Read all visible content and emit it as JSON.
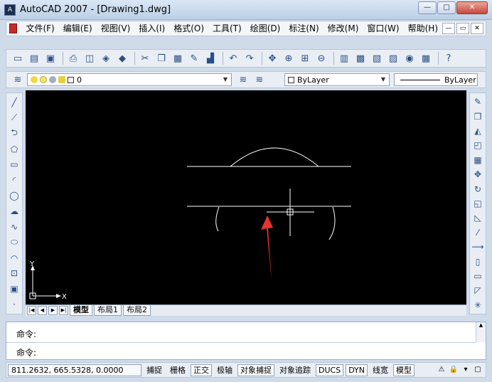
{
  "window": {
    "title": "AutoCAD 2007 - [Drawing1.dwg]",
    "app_icon_text": "A",
    "minimize": "—",
    "maximize": "□",
    "close": "✕"
  },
  "menu": {
    "items": [
      {
        "label": "文件(F)",
        "name": "menu-file"
      },
      {
        "label": "编辑(E)",
        "name": "menu-edit"
      },
      {
        "label": "视图(V)",
        "name": "menu-view"
      },
      {
        "label": "插入(I)",
        "name": "menu-insert"
      },
      {
        "label": "格式(O)",
        "name": "menu-format"
      },
      {
        "label": "工具(T)",
        "name": "menu-tools"
      },
      {
        "label": "绘图(D)",
        "name": "menu-draw"
      },
      {
        "label": "标注(N)",
        "name": "menu-dimension"
      },
      {
        "label": "修改(M)",
        "name": "menu-modify"
      },
      {
        "label": "窗口(W)",
        "name": "menu-window"
      },
      {
        "label": "帮助(H)",
        "name": "menu-help"
      }
    ],
    "doc_minimize": "—",
    "doc_restore": "▭",
    "doc_close": "✕"
  },
  "standard_toolbar": {
    "icons": [
      {
        "name": "new-icon",
        "glyph": "▭"
      },
      {
        "name": "open-icon",
        "glyph": "▤"
      },
      {
        "name": "save-icon",
        "glyph": "▣"
      },
      {
        "sep": true
      },
      {
        "name": "print-icon",
        "glyph": "⎙"
      },
      {
        "name": "print-preview-icon",
        "glyph": "◫"
      },
      {
        "name": "publish-icon",
        "glyph": "◈"
      },
      {
        "name": "3d-dwf-icon",
        "glyph": "◆"
      },
      {
        "sep": true
      },
      {
        "name": "cut-icon",
        "glyph": "✂"
      },
      {
        "name": "copy-icon",
        "glyph": "❐"
      },
      {
        "name": "paste-icon",
        "glyph": "▦"
      },
      {
        "name": "match-properties-icon",
        "glyph": "✎"
      },
      {
        "name": "block-editor-icon",
        "glyph": "▟"
      },
      {
        "sep": true
      },
      {
        "name": "undo-icon",
        "glyph": "↶"
      },
      {
        "name": "redo-icon",
        "glyph": "↷"
      },
      {
        "sep": true
      },
      {
        "name": "pan-icon",
        "glyph": "✥"
      },
      {
        "name": "zoom-realtime-icon",
        "glyph": "⊕"
      },
      {
        "name": "zoom-window-icon",
        "glyph": "⊞"
      },
      {
        "name": "zoom-previous-icon",
        "glyph": "⊖"
      },
      {
        "sep": true
      },
      {
        "name": "properties-icon",
        "glyph": "▥"
      },
      {
        "name": "design-center-icon",
        "glyph": "▩"
      },
      {
        "name": "tool-palettes-icon",
        "glyph": "▧"
      },
      {
        "name": "sheet-set-icon",
        "glyph": "▨"
      },
      {
        "name": "markup-icon",
        "glyph": "◉"
      },
      {
        "name": "calculator-icon",
        "glyph": "▦"
      },
      {
        "sep": true
      },
      {
        "name": "help-icon",
        "glyph": "?"
      }
    ]
  },
  "layers_toolbar": {
    "layer_manager_glyph": "≋",
    "current_layer": "0",
    "make_current_glyph": "≋",
    "previous_layer_glyph": "≋",
    "color": "ByLayer",
    "linetype": "ByLayer"
  },
  "left_toolbar": {
    "icons": [
      {
        "name": "line-icon",
        "glyph": "╱"
      },
      {
        "name": "construction-line-icon",
        "glyph": "⟋"
      },
      {
        "name": "polyline-icon",
        "glyph": "⮌"
      },
      {
        "name": "polygon-icon",
        "glyph": "⬠"
      },
      {
        "name": "rectangle-icon",
        "glyph": "▭"
      },
      {
        "name": "arc-icon",
        "glyph": "◜"
      },
      {
        "name": "circle-icon",
        "glyph": "◯"
      },
      {
        "name": "revision-cloud-icon",
        "glyph": "☁"
      },
      {
        "name": "spline-icon",
        "glyph": "∿"
      },
      {
        "name": "ellipse-icon",
        "glyph": "⬭"
      },
      {
        "name": "ellipse-arc-icon",
        "glyph": "◠"
      },
      {
        "name": "insert-block-icon",
        "glyph": "⊡"
      },
      {
        "name": "make-block-icon",
        "glyph": "▣"
      },
      {
        "name": "point-icon",
        "glyph": "·"
      }
    ]
  },
  "right_toolbar": {
    "icons": [
      {
        "name": "erase-icon",
        "glyph": "✎"
      },
      {
        "name": "copy-object-icon",
        "glyph": "❐"
      },
      {
        "name": "mirror-icon",
        "glyph": "◭"
      },
      {
        "name": "offset-icon",
        "glyph": "◰"
      },
      {
        "name": "array-icon",
        "glyph": "▦"
      },
      {
        "name": "move-icon",
        "glyph": "✥"
      },
      {
        "name": "rotate-icon",
        "glyph": "↻"
      },
      {
        "name": "scale-icon",
        "glyph": "◱"
      },
      {
        "name": "stretch-icon",
        "glyph": "◺"
      },
      {
        "name": "trim-icon",
        "glyph": "⁄"
      },
      {
        "name": "extend-icon",
        "glyph": "⟶"
      },
      {
        "name": "break-icon",
        "glyph": "▯"
      },
      {
        "name": "join-icon",
        "glyph": "▭"
      },
      {
        "name": "chamfer-icon",
        "glyph": "◸"
      },
      {
        "name": "explode-icon",
        "glyph": "✳"
      }
    ]
  },
  "drawing": {
    "ucs_x_label": "X",
    "ucs_y_label": "Y",
    "arrow_color": "#e8322c"
  },
  "layout_tabs": {
    "nav": [
      "|◀",
      "◀",
      "▶",
      "▶|"
    ],
    "tabs": [
      {
        "label": "模型",
        "active": true
      },
      {
        "label": "布局1",
        "active": false
      },
      {
        "label": "布局2",
        "active": false
      }
    ]
  },
  "command": {
    "line1": "命令:",
    "line2": "命令:"
  },
  "status": {
    "coords": "811.2632, 665.5328, 0.0000",
    "buttons": [
      {
        "label": "捕捉",
        "name": "snap-button",
        "on": false
      },
      {
        "label": "栅格",
        "name": "grid-button",
        "on": false
      },
      {
        "label": "正交",
        "name": "ortho-button",
        "on": true
      },
      {
        "label": "极轴",
        "name": "polar-button",
        "on": false
      },
      {
        "label": "对象捕捉",
        "name": "osnap-button",
        "on": true
      },
      {
        "label": "对象追踪",
        "name": "otrack-button",
        "on": false
      },
      {
        "label": "DUCS",
        "name": "ducs-button",
        "on": true
      },
      {
        "label": "DYN",
        "name": "dyn-button",
        "on": true
      },
      {
        "label": "线宽",
        "name": "lwt-button",
        "on": false
      },
      {
        "label": "模型",
        "name": "model-button",
        "on": true
      }
    ],
    "tray": [
      {
        "name": "comm-center-icon",
        "glyph": "⚠"
      },
      {
        "name": "lock-icon",
        "glyph": "🔒"
      },
      {
        "name": "tray-settings-icon",
        "glyph": "▾"
      },
      {
        "name": "clean-screen-icon",
        "glyph": "▢"
      }
    ]
  }
}
